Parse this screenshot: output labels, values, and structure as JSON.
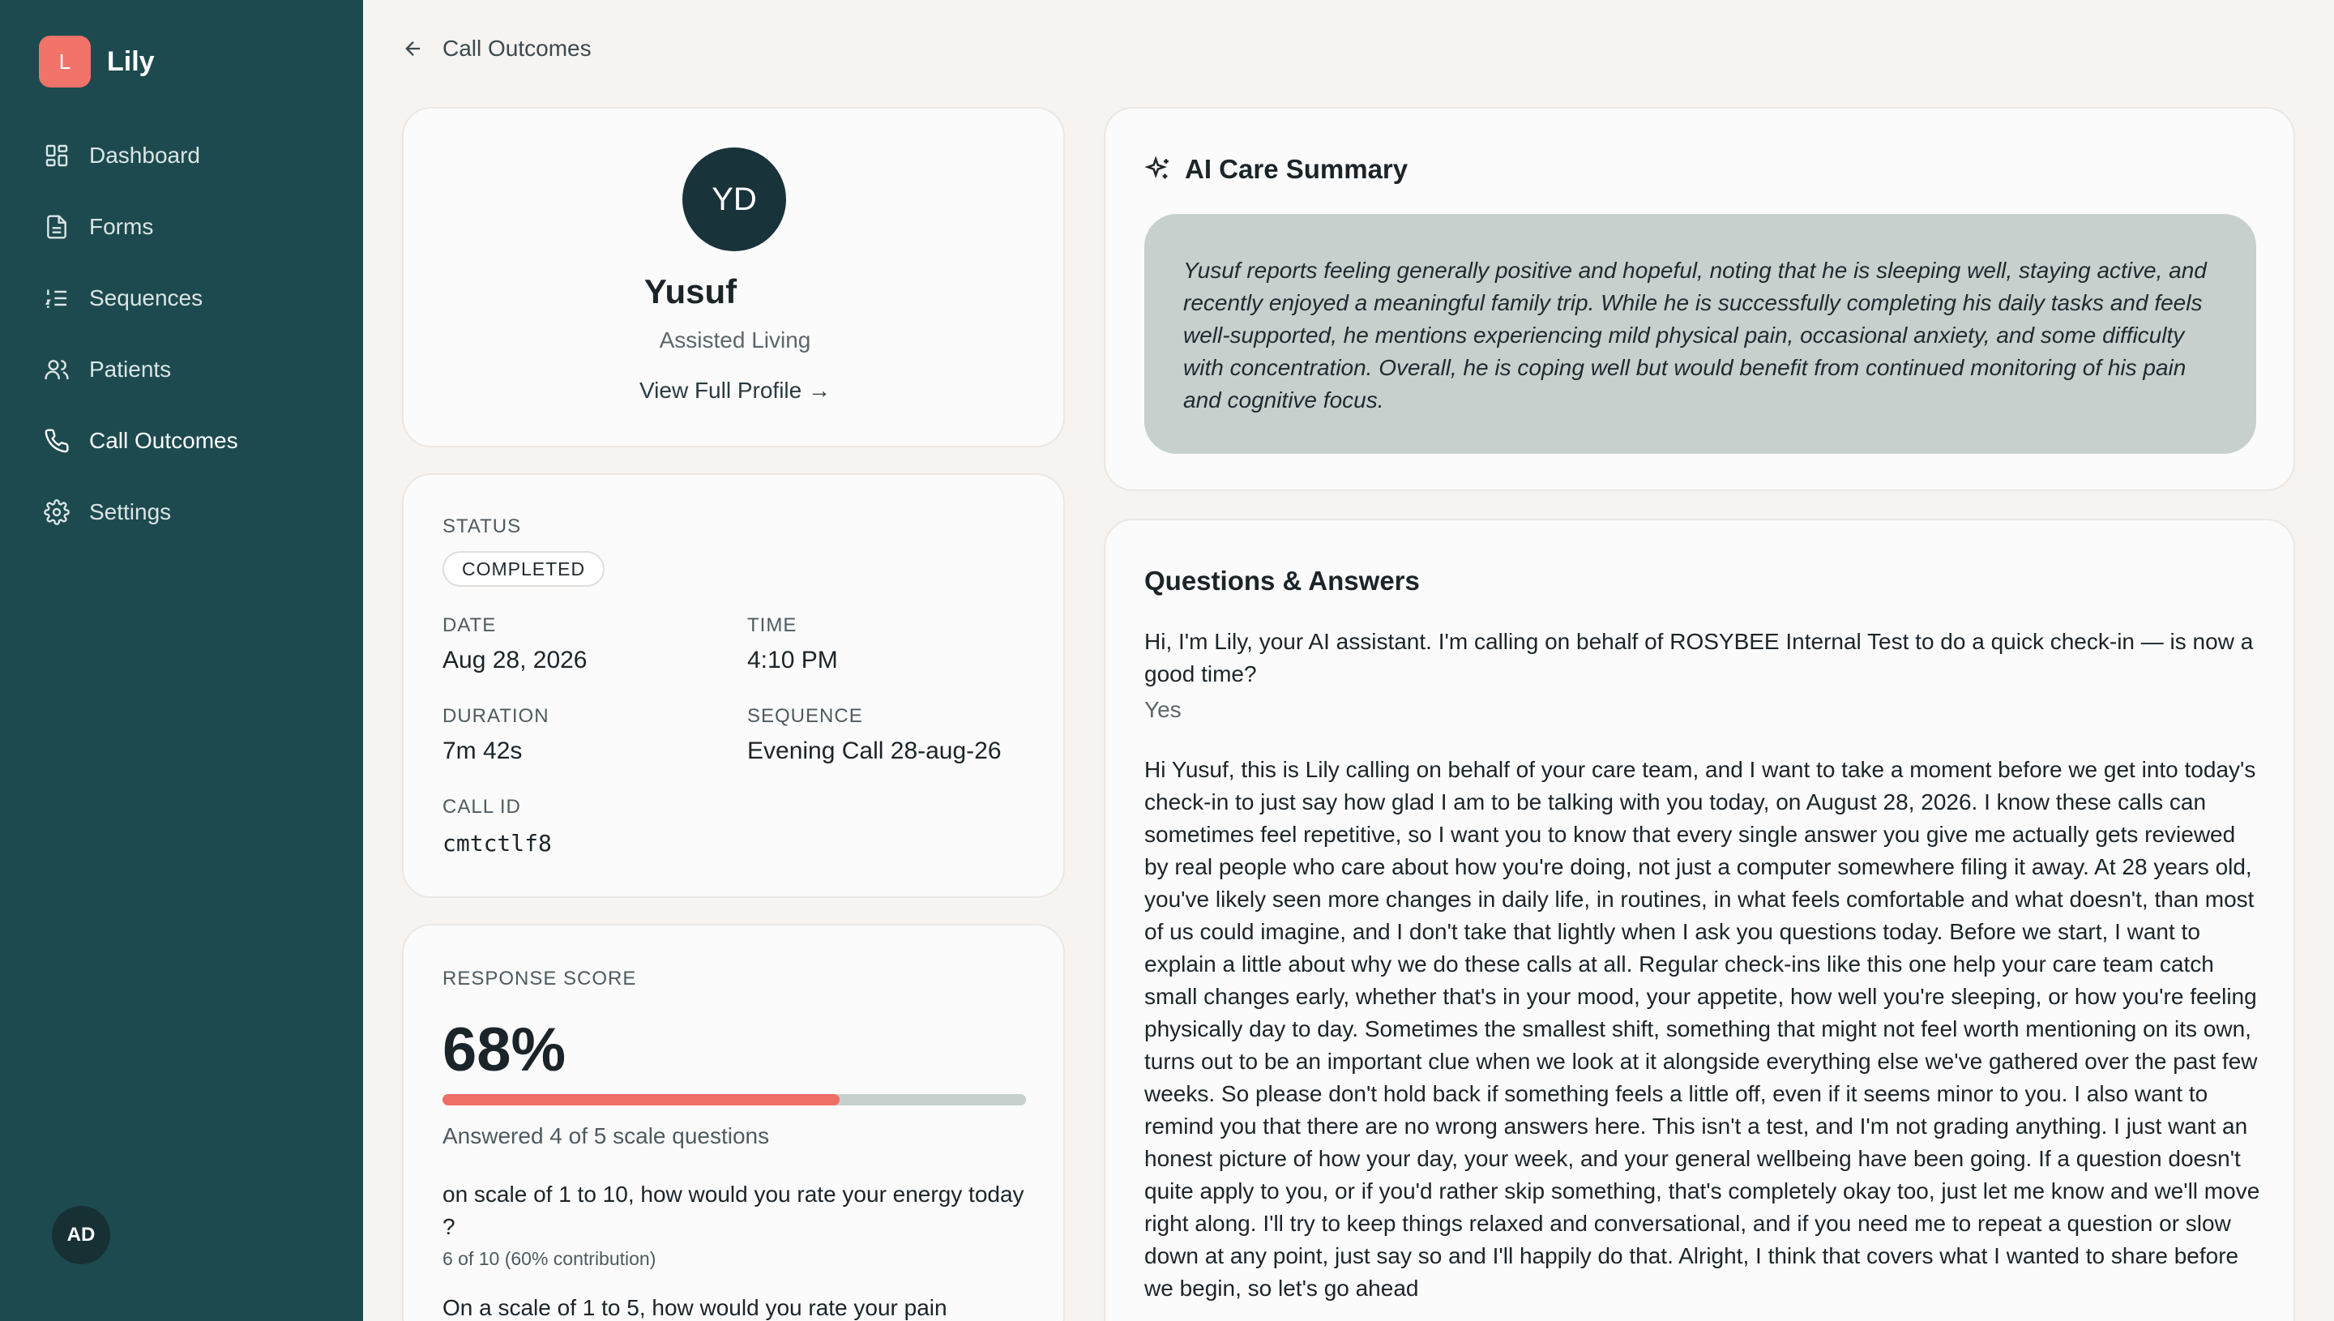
{
  "app": {
    "logo_letter": "L",
    "name": "Lily"
  },
  "sidebar": {
    "items": [
      {
        "label": "Dashboard",
        "icon": "grid-icon"
      },
      {
        "label": "Forms",
        "icon": "document-icon"
      },
      {
        "label": "Sequences",
        "icon": "list-ordered-icon"
      },
      {
        "label": "Patients",
        "icon": "users-icon"
      },
      {
        "label": "Call Outcomes",
        "icon": "phone-icon",
        "active": true
      },
      {
        "label": "Settings",
        "icon": "gear-icon"
      }
    ],
    "user_initials": "AD"
  },
  "breadcrumb": {
    "back_label": "Call Outcomes"
  },
  "patient": {
    "initials": "YD",
    "name": "Yusuf",
    "facility": "Assisted Living",
    "profile_link": "View Full Profile →"
  },
  "details": {
    "status_label": "STATUS",
    "status": "COMPLETED",
    "date_label": "DATE",
    "date": "Aug 28, 2026",
    "time_label": "TIME",
    "time": "4:10 PM",
    "duration_label": "DURATION",
    "duration": "7m 42s",
    "sequence_label": "SEQUENCE",
    "sequence": "Evening Call 28-aug-26",
    "call_id_label": "CALL ID",
    "call_id": "cmtctlf8"
  },
  "score": {
    "label": "RESPONSE SCORE",
    "value_text": "68%",
    "value_fraction": 0.68,
    "summary": "Answered 4 of 5 scale questions",
    "questions": [
      {
        "text": "on scale of 1 to 10, how would you rate your energy today ?",
        "result": "6 of 10 (60% contribution)"
      },
      {
        "text": "On a scale of 1 to 5, how would you rate your pain"
      }
    ]
  },
  "ai_summary": {
    "title": "AI Care Summary",
    "text": "Yusuf reports feeling generally positive and hopeful, noting that he is sleeping well, staying active, and recently enjoyed a meaningful family trip. While he is successfully completing his daily tasks and feels well-supported, he mentions experiencing mild physical pain, occasional anxiety, and some difficulty with concentration. Overall, he is coping well but would benefit from continued monitoring of his pain and cognitive focus."
  },
  "qa": {
    "title": "Questions & Answers",
    "items": [
      {
        "question": "Hi, I'm Lily, your AI assistant. I'm calling on behalf of ROSYBEE Internal Test to do a quick check-in — is now a good time?",
        "answer": "Yes"
      },
      {
        "question": "Hi Yusuf, this is Lily calling on behalf of your care team, and I want to take a moment before we get into today's check-in to just say how glad I am to be talking with you today, on August 28, 2026. I know these calls can sometimes feel repetitive, so I want you to know that every single answer you give me actually gets reviewed by real people who care about how you're doing, not just a computer somewhere filing it away. At 28 years old, you've likely seen more changes in daily life, in routines, in what feels comfortable and what doesn't, than most of us could imagine, and I don't take that lightly when I ask you questions today. Before we start, I want to explain a little about why we do these calls at all. Regular check-ins like this one help your care team catch small changes early, whether that's in your mood, your appetite, how well you're sleeping, or how you're feeling physically day to day. Sometimes the smallest shift, something that might not feel worth mentioning on its own, turns out to be an important clue when we look at it alongside everything else we've gathered over the past few weeks. So please don't hold back if something feels a little off, even if it seems minor to you. I also want to remind you that there are no wrong answers here. This isn't a test, and I'm not grading anything. I just want an honest picture of how your day, your week, and your general wellbeing have been going. If a question doesn't quite apply to you, or if you'd rather skip something, that's completely okay too, just let me know and we'll move right along. I'll try to keep things relaxed and conversational, and if you need me to repeat a question or slow down at any point, just say so and I'll happily do that. Alright, I think that covers what I wanted to share before we begin, so let's go ahead"
      }
    ]
  }
}
